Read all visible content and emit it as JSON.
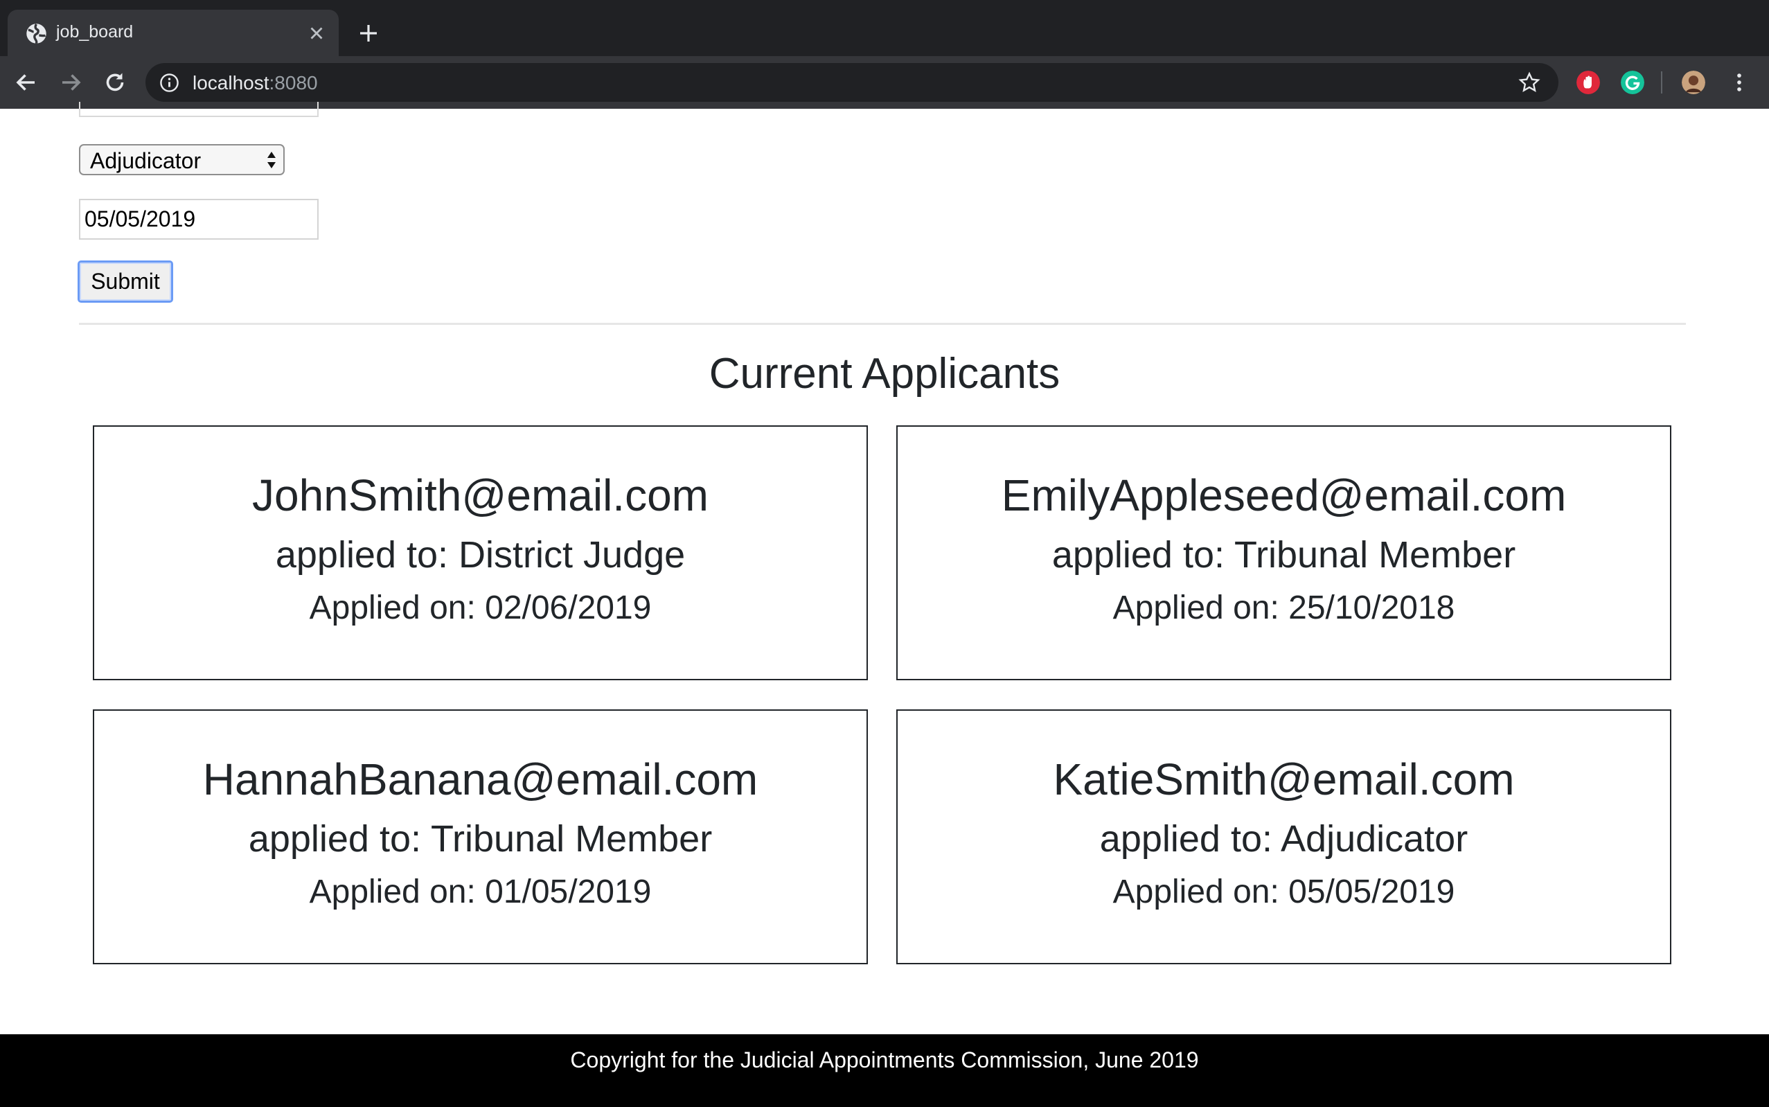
{
  "browser": {
    "tab_title": "job_board",
    "url_host": "localhost",
    "url_port": ":8080"
  },
  "form": {
    "role_selected": "Adjudicator",
    "date_value": "05/05/2019",
    "submit_label": "Submit"
  },
  "applicants_section": {
    "title": "Current Applicants",
    "cards": [
      {
        "email": "JohnSmith@email.com",
        "applied_to": "applied to: District Judge",
        "applied_on": "Applied on: 02/06/2019"
      },
      {
        "email": "EmilyAppleseed@email.com",
        "applied_to": "applied to: Tribunal Member",
        "applied_on": "Applied on: 25/10/2018"
      },
      {
        "email": "HannahBanana@email.com",
        "applied_to": "applied to: Tribunal Member",
        "applied_on": "Applied on: 01/05/2019"
      },
      {
        "email": "KatieSmith@email.com",
        "applied_to": "applied to: Adjudicator",
        "applied_on": "Applied on: 05/05/2019"
      }
    ]
  },
  "footer": {
    "text": "Copyright for the Judicial Appointments Commission, June 2019"
  },
  "colors": {
    "chrome_dark": "#202124",
    "chrome_toolbar": "#35363a",
    "footer_bg": "#000000",
    "focus_ring": "#6b9bf5"
  }
}
